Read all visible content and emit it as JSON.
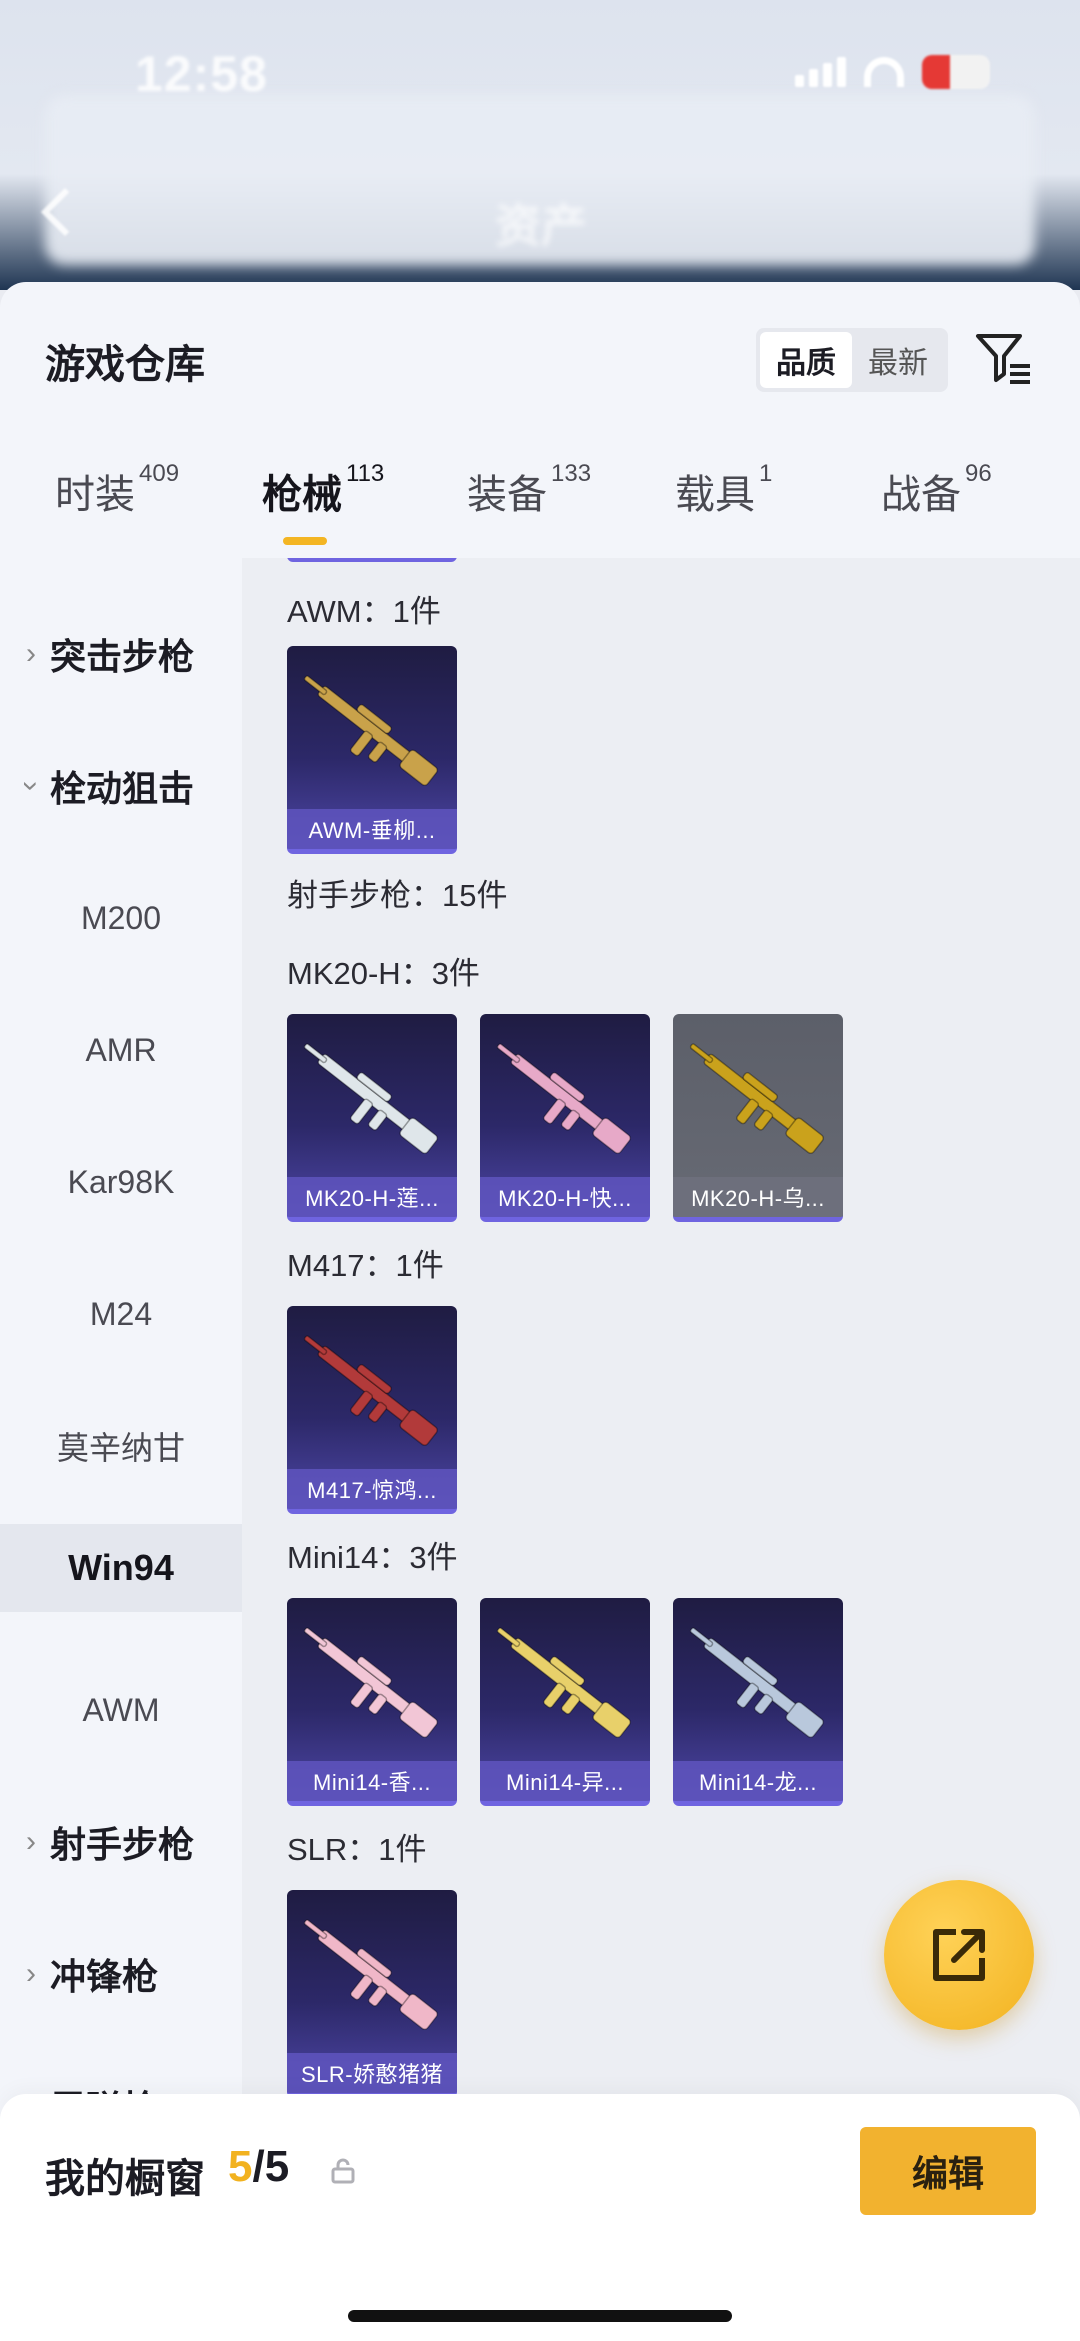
{
  "status_bar": {
    "time": "12:58"
  },
  "header": {
    "title": "资产"
  },
  "panel": {
    "title": "游戏仓库",
    "sort_options": [
      "品质",
      "最新"
    ],
    "sort_active": "品质"
  },
  "tabs": [
    {
      "label": "时装",
      "count": "409"
    },
    {
      "label": "枪械",
      "count": "113"
    },
    {
      "label": "装备",
      "count": "133"
    },
    {
      "label": "载具",
      "count": "1"
    },
    {
      "label": "战备",
      "count": "96"
    }
  ],
  "active_tab": "枪械",
  "sidebar": {
    "items": [
      {
        "label": "突击步枪",
        "kind": "group",
        "expanded": false
      },
      {
        "label": "栓动狙击",
        "kind": "group",
        "expanded": true
      },
      {
        "label": "M200",
        "kind": "sub"
      },
      {
        "label": "AMR",
        "kind": "sub"
      },
      {
        "label": "Kar98K",
        "kind": "sub"
      },
      {
        "label": "M24",
        "kind": "sub"
      },
      {
        "label": "莫辛纳甘",
        "kind": "sub"
      },
      {
        "label": "Win94",
        "kind": "sub",
        "selected": true
      },
      {
        "label": "AWM",
        "kind": "sub"
      },
      {
        "label": "射手步枪",
        "kind": "group",
        "expanded": false
      },
      {
        "label": "冲锋枪",
        "kind": "group",
        "expanded": false
      },
      {
        "label": "霰弹枪",
        "kind": "group",
        "expanded": false
      }
    ]
  },
  "content": {
    "sections": [
      {
        "label": "AWM：1件",
        "items": [
          {
            "name": "AWM-垂柳...",
            "rarity": "purple",
            "gun_color": "#c9a24a"
          }
        ]
      },
      {
        "label": "射手步枪：15件",
        "items": []
      },
      {
        "label": "MK20-H：3件",
        "items": [
          {
            "name": "MK20-H-莲...",
            "rarity": "purple",
            "gun_color": "#dfe6ea"
          },
          {
            "name": "MK20-H-快...",
            "rarity": "purple",
            "gun_color": "#e7a9c8"
          },
          {
            "name": "MK20-H-乌...",
            "rarity": "gray",
            "gun_color": "#caa21c"
          }
        ]
      },
      {
        "label": "M417：1件",
        "items": [
          {
            "name": "M417-惊鸿...",
            "rarity": "purple",
            "gun_color": "#b23a3a"
          }
        ]
      },
      {
        "label": "Mini14：3件",
        "items": [
          {
            "name": "Mini14-香...",
            "rarity": "purple",
            "gun_color": "#f2c6d6"
          },
          {
            "name": "Mini14-异...",
            "rarity": "purple",
            "gun_color": "#e8d06a"
          },
          {
            "name": "Mini14-龙...",
            "rarity": "purple",
            "gun_color": "#b9c8dc"
          }
        ]
      },
      {
        "label": "SLR：1件",
        "items": [
          {
            "name": "SLR-娇憨猪猪",
            "rarity": "purple",
            "gun_color": "#f0b7c8"
          }
        ]
      }
    ]
  },
  "showcase": {
    "label": "我的橱窗",
    "current": "5",
    "total": "/5",
    "edit_label": "编辑"
  },
  "colors": {
    "accent": "#f2b22f",
    "rarity_purple": "#6f64e0"
  }
}
